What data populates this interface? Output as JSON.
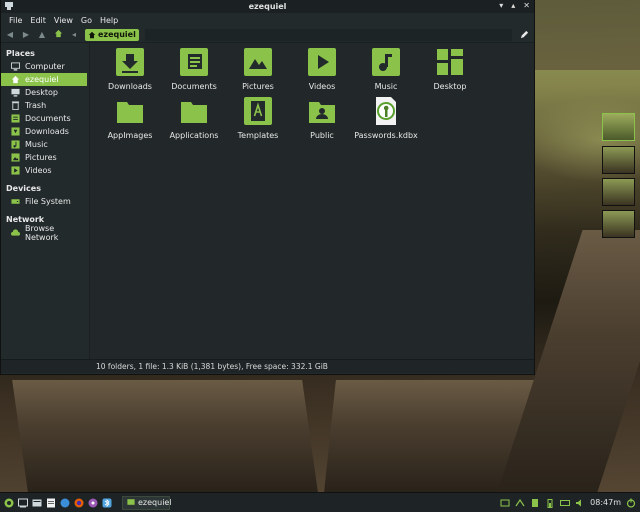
{
  "window": {
    "title": "ezequiel",
    "menu": [
      "File",
      "Edit",
      "View",
      "Go",
      "Help"
    ],
    "breadcrumb": "ezequiel",
    "controls": {
      "minimize": "▾",
      "maximize": "▴",
      "close": "✕"
    }
  },
  "sidebar": {
    "places_header": "Places",
    "places": [
      {
        "label": "Computer",
        "icon": "computer-icon",
        "active": false
      },
      {
        "label": "ezequiel",
        "icon": "home-icon",
        "active": true
      },
      {
        "label": "Desktop",
        "icon": "desktop-icon",
        "active": false
      },
      {
        "label": "Trash",
        "icon": "trash-icon",
        "active": false
      },
      {
        "label": "Documents",
        "icon": "documents-icon",
        "active": false
      },
      {
        "label": "Downloads",
        "icon": "downloads-icon",
        "active": false
      },
      {
        "label": "Music",
        "icon": "music-icon",
        "active": false
      },
      {
        "label": "Pictures",
        "icon": "pictures-icon",
        "active": false
      },
      {
        "label": "Videos",
        "icon": "videos-icon",
        "active": false
      }
    ],
    "devices_header": "Devices",
    "devices": [
      {
        "label": "File System",
        "icon": "drive-icon"
      }
    ],
    "network_header": "Network",
    "network": [
      {
        "label": "Browse Network",
        "icon": "cloud-icon"
      }
    ]
  },
  "files": [
    {
      "label": "Downloads",
      "icon": "folder-downloads-icon"
    },
    {
      "label": "Documents",
      "icon": "folder-documents-icon"
    },
    {
      "label": "Pictures",
      "icon": "folder-pictures-icon"
    },
    {
      "label": "Videos",
      "icon": "folder-videos-icon"
    },
    {
      "label": "Music",
      "icon": "folder-music-icon"
    },
    {
      "label": "Desktop",
      "icon": "folder-desktop-icon"
    },
    {
      "label": "AppImages",
      "icon": "folder-icon"
    },
    {
      "label": "Applications",
      "icon": "folder-icon"
    },
    {
      "label": "Templates",
      "icon": "folder-templates-icon"
    },
    {
      "label": "Public",
      "icon": "folder-public-icon"
    },
    {
      "label": "Passwords.kdbx",
      "icon": "keepass-file-icon"
    }
  ],
  "status": "10 folders, 1 file: 1.3 KiB (1,381 bytes), Free space: 332.1 GiB",
  "panel": {
    "task_label": "ezequiel",
    "clock": "08:47",
    "clock_suffix": "m"
  },
  "colors": {
    "accent": "#8bc34a",
    "window_bg": "#232a2c"
  }
}
